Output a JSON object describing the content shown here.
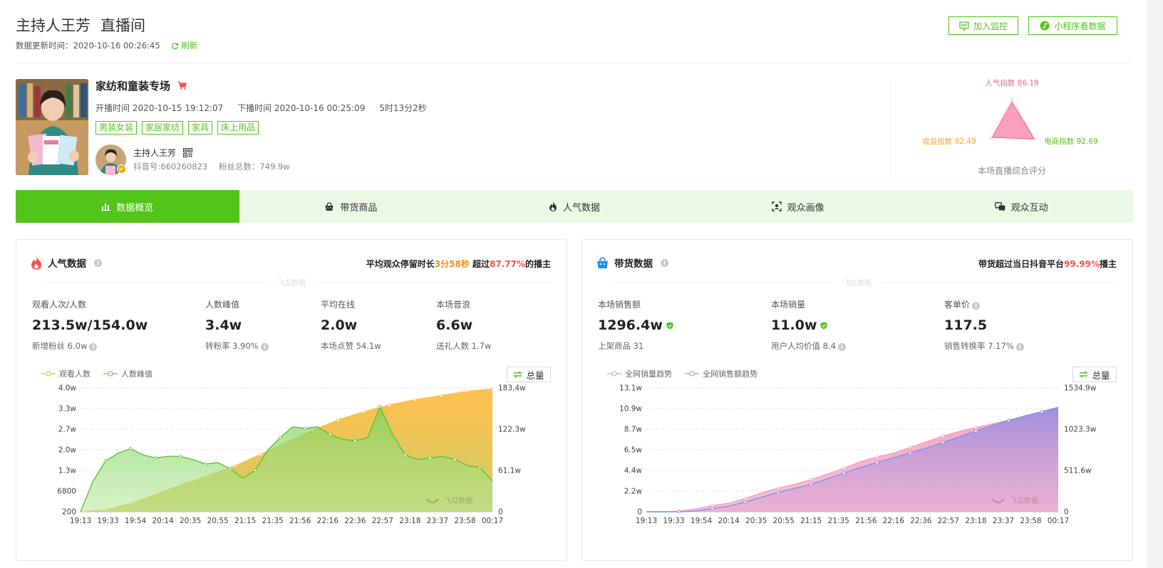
{
  "header": {
    "title": "主持人王芳",
    "subtitle": "直播间",
    "update_label": "数据更新时间：2020-10-16 00:26:45",
    "refresh_label": "刷新",
    "monitor_btn": "加入监控",
    "miniapp_btn": "小程序看数据"
  },
  "room": {
    "name": "家纺和童装专场",
    "start": "开播时间 2020-10-15 19:12:07",
    "end": "下播时间 2020-10-16 00:25:09",
    "duration": "5时13分2秒",
    "tags": [
      "男装女装",
      "家居家纺",
      "家具",
      "床上用品"
    ]
  },
  "host": {
    "name": "主持人王芳",
    "douyin_id": "抖音号:660260823",
    "fans": "粉丝总数：749.9w"
  },
  "radar": {
    "popularity": "人气指数 86.19",
    "income": "收益指数 82.49",
    "ecommerce": "电商指数 92.69",
    "caption": "本场直播综合评分",
    "values": [
      86.19,
      92.69,
      82.49
    ]
  },
  "tabs": [
    {
      "label": "数据概览",
      "icon": "bar-chart-icon"
    },
    {
      "label": "带货商品",
      "icon": "shopping-bag-icon"
    },
    {
      "label": "人气数据",
      "icon": "flame-icon"
    },
    {
      "label": "观众画像",
      "icon": "face-scan-icon"
    },
    {
      "label": "观众互动",
      "icon": "chat-icon"
    }
  ],
  "popularity": {
    "title": "人气数据",
    "note_pre": "平均观众停留时长",
    "note_time": "3分58秒",
    "note_mid": " 超过",
    "note_pct": "87.77%",
    "note_post": "的播主",
    "watermark": "飞瓜数据",
    "metrics": [
      {
        "label": "观看人次/人数",
        "value": "213.5w/154.0w",
        "sub": "新增粉丝 6.0w"
      },
      {
        "label": "人数峰值",
        "value": "3.4w",
        "sub": "转粉率 3.90%"
      },
      {
        "label": "平均在线",
        "value": "2.0w",
        "sub": "本场点赞 54.1w"
      },
      {
        "label": "本场音浪",
        "value": "6.6w",
        "sub": "送礼人数 1.7w"
      }
    ],
    "legend": [
      "观看人数",
      "人数峰值"
    ],
    "total_btn": "总量"
  },
  "sales": {
    "title": "带货数据",
    "note_pre": "带货超过当日抖音平台",
    "note_pct": "99.99%",
    "note_post": "播主",
    "watermark": "飞瓜数据",
    "metrics": [
      {
        "label": "本场销售额",
        "value": "1296.4w",
        "sub": "上架商品 31"
      },
      {
        "label": "本场销量",
        "value": "11.0w",
        "sub": "用户人均价值 8.4"
      },
      {
        "label": "客单价",
        "value": "117.5",
        "sub": "销售转换率 7.17%"
      }
    ],
    "legend": [
      "全网销量趋势",
      "全网销售额趋势"
    ],
    "total_btn": "总量"
  },
  "chart_data": [
    {
      "type": "area",
      "x": [
        "19:13",
        "19:33",
        "19:54",
        "20:14",
        "20:35",
        "20:55",
        "21:15",
        "21:35",
        "21:56",
        "22:16",
        "22:36",
        "22:57",
        "23:18",
        "23:37",
        "23:58",
        "00:17"
      ],
      "yticks_left": [
        "200",
        "6800",
        "1.3w",
        "2.0w",
        "2.7w",
        "3.3w",
        "4.0w"
      ],
      "yticks_right": [
        "0",
        "61.1w",
        "122.3w",
        "183.4w"
      ],
      "ylim_left": [
        200,
        40000
      ],
      "ylim_right": [
        0,
        1834000
      ],
      "colors": {
        "watch": "#ffbd45",
        "peak": "#7cd35a"
      },
      "series": [
        {
          "name": "观看人数",
          "axis": "right",
          "values": [
            0,
            30000,
            130000,
            270000,
            410000,
            540000,
            680000,
            850000,
            1030000,
            1200000,
            1360000,
            1480000,
            1580000,
            1660000,
            1720000,
            1780000,
            1820000
          ]
        },
        {
          "name": "人数峰值",
          "axis": "left",
          "values": [
            200,
            10000,
            16500,
            19000,
            20500,
            18500,
            17500,
            18000,
            18000,
            17000,
            15500,
            16000,
            14000,
            11000,
            13500,
            20000,
            24000,
            27500,
            27000,
            27500,
            25000,
            23500,
            23000,
            24000,
            34000,
            25000,
            18500,
            17000,
            17500,
            18000,
            17000,
            15000,
            14500,
            10000
          ]
        }
      ]
    },
    {
      "type": "area",
      "x": [
        "19:13",
        "19:33",
        "19:54",
        "20:14",
        "20:35",
        "20:55",
        "21:15",
        "21:35",
        "21:56",
        "22:16",
        "22:36",
        "22:57",
        "23:18",
        "23:37",
        "23:58",
        "00:17"
      ],
      "yticks_left": [
        "0",
        "2.2w",
        "4.4w",
        "6.5w",
        "8.7w",
        "10.9w",
        "13.1w"
      ],
      "yticks_right": [
        "0",
        "511.6w",
        "1023.3w",
        "1534.9w"
      ],
      "ylim_left": [
        0,
        131000
      ],
      "ylim_right": [
        0,
        15349000
      ],
      "colors": {
        "volume": "#f3a3c4",
        "amount": "#9b8fe3"
      },
      "series": [
        {
          "name": "全网销量趋势",
          "axis": "left",
          "values": [
            0,
            0,
            500,
            3000,
            6500,
            9000,
            14000,
            20000,
            25000,
            29000,
            34000,
            40000,
            46000,
            53000,
            58000,
            62000,
            68000,
            74000,
            80000,
            85000,
            89000,
            93000,
            97000,
            101000,
            106000,
            110000
          ]
        },
        {
          "name": "全网销售额趋势",
          "axis": "right",
          "values": [
            0,
            0,
            0,
            100000,
            400000,
            700000,
            1200000,
            1800000,
            2400000,
            2900000,
            3400000,
            4100000,
            4800000,
            5500000,
            6100000,
            6700000,
            7300000,
            7900000,
            8600000,
            9300000,
            10000000,
            10700000,
            11300000,
            11900000,
            12400000,
            12950000
          ]
        }
      ]
    }
  ]
}
